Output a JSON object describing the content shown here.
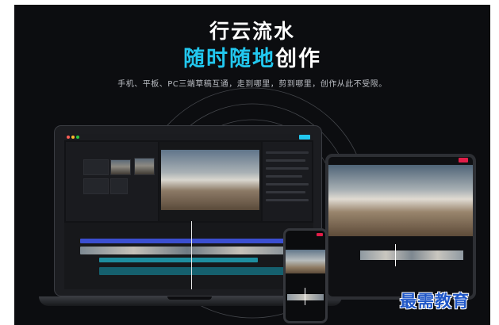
{
  "hero": {
    "title_line1": "行云流水",
    "title_line2_highlight": "随时随地",
    "title_line2_rest": "创作",
    "subtitle": "手机、平板、PC三端草稿互通，走到哪里，剪到哪里，创作从此不受限。"
  },
  "colors": {
    "background": "#0c0d10",
    "accent": "#22c7ee",
    "tablet_export": "#e11d48",
    "timeline_blue": "#3b4fd1",
    "timeline_teal": "#1e8ea0"
  },
  "devices": {
    "laptop": {
      "content": "video-editor-desktop"
    },
    "tablet": {
      "content": "video-editor-tablet"
    },
    "phone": {
      "content": "video-editor-phone"
    }
  },
  "watermark": {
    "text": "最需教育"
  }
}
